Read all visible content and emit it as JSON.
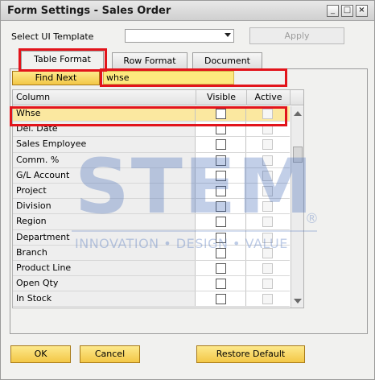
{
  "window": {
    "title": "Form Settings - Sales Order"
  },
  "template": {
    "label": "Select UI Template",
    "value": "",
    "apply_label": "Apply"
  },
  "tabs": [
    {
      "label": "Table Format",
      "active": true
    },
    {
      "label": "Row Format",
      "active": false
    },
    {
      "label": "Document",
      "active": false
    }
  ],
  "search": {
    "button_label": "Find Next",
    "value": "whse"
  },
  "grid": {
    "headers": {
      "column": "Column",
      "visible": "Visible",
      "active": "Active"
    },
    "rows": [
      {
        "label": "Whse",
        "visible": false,
        "active": false,
        "selected": true
      },
      {
        "label": "Del. Date",
        "visible": false,
        "active": false
      },
      {
        "label": "Sales Employee",
        "visible": false,
        "active": false
      },
      {
        "label": "Comm. %",
        "visible": false,
        "active": false
      },
      {
        "label": "G/L Account",
        "visible": false,
        "active": false
      },
      {
        "label": "Project",
        "visible": false,
        "active": false
      },
      {
        "label": "Division",
        "visible": false,
        "active": false
      },
      {
        "label": "Region",
        "visible": false,
        "active": false
      },
      {
        "label": "Department",
        "visible": false,
        "active": false
      },
      {
        "label": "Branch",
        "visible": false,
        "active": false
      },
      {
        "label": "Product Line",
        "visible": false,
        "active": false
      },
      {
        "label": "Open Qty",
        "visible": false,
        "active": false
      },
      {
        "label": "In Stock",
        "visible": false,
        "active": false
      }
    ]
  },
  "buttons": {
    "ok": "OK",
    "cancel": "Cancel",
    "restore": "Restore Default"
  },
  "watermark": {
    "brand": "STEM",
    "registered": "®",
    "tagline": "INNOVATION • DESIGN • VALUE"
  },
  "colors": {
    "highlight": "#e2141b",
    "button_gold": "#f3c746",
    "selected_row": "#fbe8a0",
    "watermark": "#466eb9"
  }
}
